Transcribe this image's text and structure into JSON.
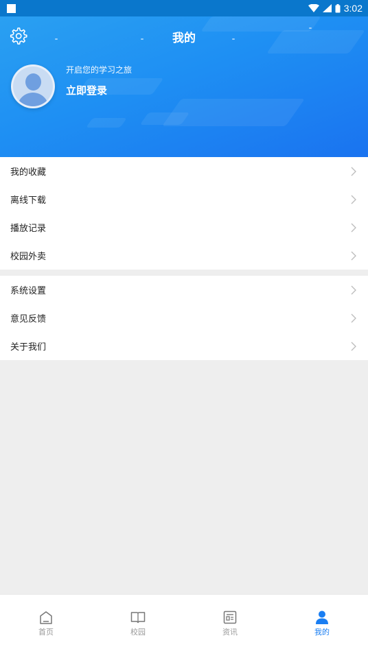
{
  "status_bar": {
    "time": "3:02"
  },
  "header": {
    "title": "我的",
    "subtitle": "开启您的学习之旅",
    "login_label": "立即登录"
  },
  "menu_group_1": [
    {
      "label": "我的收藏"
    },
    {
      "label": "离线下载"
    },
    {
      "label": "播放记录"
    },
    {
      "label": "校园外卖"
    }
  ],
  "menu_group_2": [
    {
      "label": "系统设置"
    },
    {
      "label": "意见反馈"
    },
    {
      "label": "关于我们"
    }
  ],
  "bottom_nav": [
    {
      "label": "首页",
      "icon": "home-icon",
      "active": false
    },
    {
      "label": "校园",
      "icon": "book-icon",
      "active": false
    },
    {
      "label": "资讯",
      "icon": "news-icon",
      "active": false
    },
    {
      "label": "我的",
      "icon": "user-icon",
      "active": true
    }
  ],
  "colors": {
    "accent": "#1a7ef2",
    "status_bar": "#0a77cc",
    "header_start": "#2aa0f2",
    "header_end": "#1a73f0"
  }
}
